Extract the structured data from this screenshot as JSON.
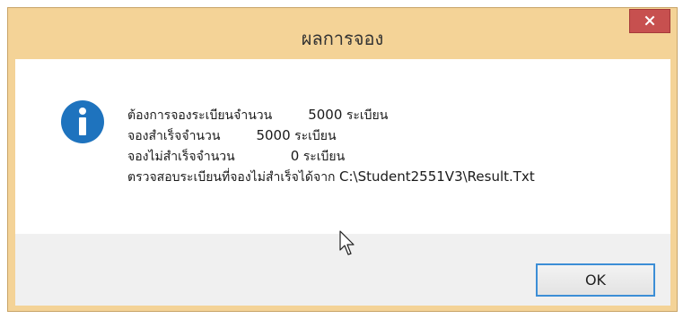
{
  "dialog": {
    "title": "ผลการจอง",
    "close_label": "✕",
    "message_lines": [
      {
        "label": "ต้องการจองระเบียนจำนวน",
        "count": "5000",
        "unit": "ระเบียน"
      },
      {
        "label": "จองสำเร็จจำนวน",
        "count": "5000",
        "unit": "ระเบียน"
      },
      {
        "label": "จองไม่สำเร็จจำนวน",
        "count": "0",
        "unit": "ระเบียน"
      }
    ],
    "check_line": {
      "label": "ตรวจสอบระเบียนที่จองไม่สำเร็จได้จาก",
      "path": "C:\\Student2551V3\\Result.Txt"
    },
    "ok_label": "OK",
    "icon": "info-icon"
  },
  "colors": {
    "frame": "#f4d397",
    "close_button": "#c7504f",
    "info_icon": "#1e73be",
    "ok_border": "#3c8ed6"
  }
}
